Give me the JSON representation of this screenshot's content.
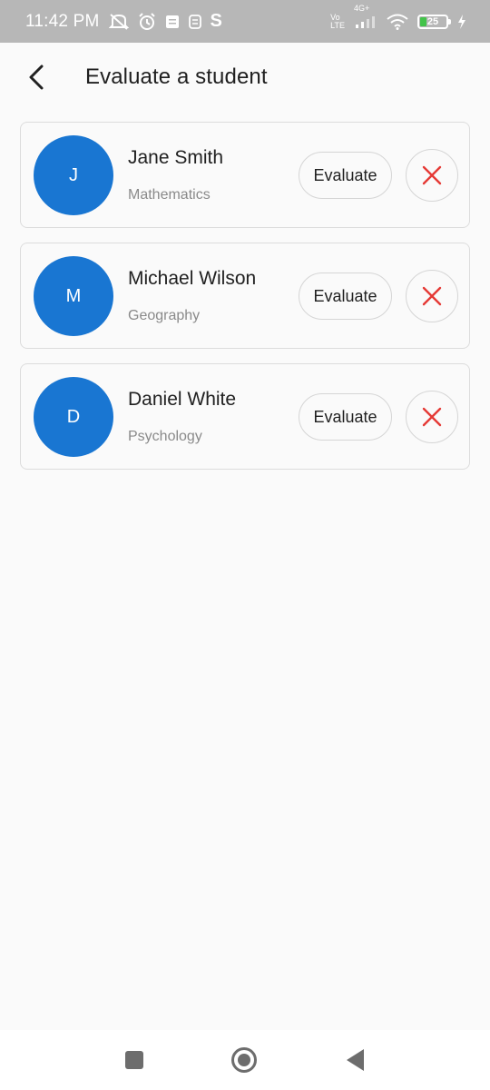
{
  "status_bar": {
    "time": "11:42 PM",
    "icons": [
      "mute-icon",
      "alarm-icon",
      "notes-icon",
      "sim-icon",
      "s-app-icon"
    ],
    "s_app_letter": "S",
    "network_label_top": "Vo",
    "network_label_bottom": "LTE",
    "network_type": "4G+",
    "battery_level": "25",
    "battery_fraction": 0.25
  },
  "app_bar": {
    "title": "Evaluate a student"
  },
  "students": [
    {
      "initial": "J",
      "name": "Jane Smith",
      "subject": "Mathematics",
      "evaluate_label": "Evaluate"
    },
    {
      "initial": "M",
      "name": "Michael Wilson",
      "subject": "Geography",
      "evaluate_label": "Evaluate"
    },
    {
      "initial": "D",
      "name": "Daniel White",
      "subject": "Psychology",
      "evaluate_label": "Evaluate"
    }
  ],
  "colors": {
    "avatar": "#1976d2",
    "remove_icon": "#e53935",
    "status_bar": "#b7b7b7"
  }
}
